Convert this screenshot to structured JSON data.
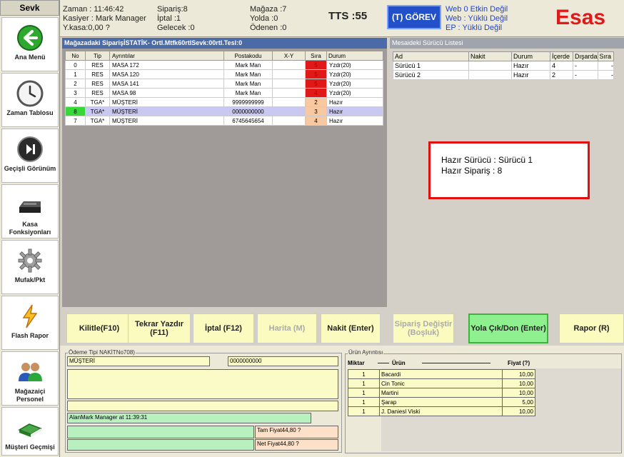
{
  "sidebar": {
    "title": "Sevk",
    "items": [
      {
        "label": "Ana Menü"
      },
      {
        "label": "Zaman Tablosu"
      },
      {
        "label": "Geçişli Görünüm"
      },
      {
        "label": "Kasa Fonksiyonları"
      },
      {
        "label": "Mufak/Pkt"
      },
      {
        "label": "Flash Rapor"
      },
      {
        "label": "Mağazaiçi Personel"
      },
      {
        "label": "Müşteri Geçmişi"
      }
    ]
  },
  "header": {
    "col1": [
      "Zaman : 11:46:42",
      "Kasiyer : Mark Manager",
      "Y.kasa:0,00 ?"
    ],
    "col2": [
      "Sipariş:8",
      "İptal :1",
      "Gelecek :0"
    ],
    "col3": [
      "Mağaza :7",
      "Yolda :0",
      "Ödenen :0"
    ],
    "tts": "TTS :55",
    "gorev": "(T) GÖREV",
    "web": [
      "Web 0 Etkin Değil",
      "Web : Yüklü Değil",
      "EP : Yüklü Değil"
    ],
    "brand": "Esas"
  },
  "orders": {
    "title": "Mağazadaki SiparişİSTATİK- Ortl.Mtfk60rtlSevk:00rtl.Tesl:0",
    "columns": [
      "No",
      "Tip",
      "Ayrıntılar",
      "Postakodu",
      "X-Y",
      "Sıra",
      "Durum"
    ],
    "rows": [
      {
        "no": "0",
        "tip": "RES",
        "detail": "MASA 172",
        "post": "Mark Man",
        "xy": "",
        "sira": "5",
        "durum": "Yzdr(20)",
        "sira_color": "#e01818",
        "no_color": ""
      },
      {
        "no": "1",
        "tip": "RES",
        "detail": "MASA 120",
        "post": "Mark Man",
        "xy": "",
        "sira": "5",
        "durum": "Yzdr(20)",
        "sira_color": "#e01818",
        "no_color": ""
      },
      {
        "no": "2",
        "tip": "RES",
        "detail": "MASA 141",
        "post": "Mark Man",
        "xy": "",
        "sira": "5",
        "durum": "Yzdr(20)",
        "sira_color": "#e01818",
        "no_color": ""
      },
      {
        "no": "3",
        "tip": "RES",
        "detail": "MASA 98",
        "post": "Mark Man",
        "xy": "",
        "sira": "4",
        "durum": "Yzdr(20)",
        "sira_color": "#e01818",
        "no_color": ""
      },
      {
        "no": "4",
        "tip": "TGA*",
        "detail": "MÜŞTERİ",
        "post": "9999999999",
        "xy": "",
        "sira": "2",
        "durum": "Hazır",
        "sira_color": "#f8c8a0",
        "no_color": ""
      },
      {
        "no": "8",
        "tip": "TGA*",
        "detail": "MÜŞTERİ",
        "post": "0000000000",
        "xy": "",
        "sira": "3",
        "durum": "Hazır",
        "sira_color": "#f8c8a0",
        "no_color": "#38d838"
      },
      {
        "no": "7",
        "tip": "TGA*",
        "detail": "MÜŞTERİ",
        "post": "6745645654",
        "xy": "",
        "sira": "4",
        "durum": "Hazır",
        "sira_color": "#f8c8a0",
        "no_color": ""
      }
    ]
  },
  "drivers": {
    "title": "Mesaideki Sürücü Listesi",
    "columns": [
      "Ad",
      "Nakit",
      "Durum",
      "İçerde",
      "Dışarda",
      "Sıra"
    ],
    "rows": [
      {
        "ad": "Sürücü 1",
        "nakit": "",
        "durum": "Hazır",
        "icerde": "4",
        "disarda": "-",
        "sira": "-"
      },
      {
        "ad": "Sürücü 2",
        "nakit": "",
        "durum": "Hazır",
        "icerde": "2",
        "disarda": "-",
        "sira": "-"
      }
    ]
  },
  "ready": {
    "driver": "Hazır Sürücü : Sürücü 1",
    "order": "Hazır Sipariş : 8"
  },
  "buttons": {
    "lock": "Kilitle(F10)",
    "reprint": "Tekrar Yazdır (F11)",
    "cancel": "İptal (F12)",
    "map": "Harita (M)",
    "cash": "Nakit (Enter)",
    "change": "Sipariş Değiştir (Boşluk)",
    "go": "Yola Çık/Don (Enter)",
    "report": "Rapor (R)"
  },
  "payment": {
    "legend": "Ödeme Tipi NAKİTNo708)",
    "customer": "MÜŞTERİ",
    "phone": "0000000000",
    "cashier_line": "AlanMark Manager    at 11:39:31",
    "total": "Tam Fiyat44,80 ?",
    "net": "Net Fiyat44,80 ?"
  },
  "products": {
    "legend": "Ürün Ayrıntısı",
    "col_qty": "Miktar",
    "col_name": "Ürün",
    "col_price": "Fiyat (?)",
    "rows": [
      {
        "qty": "1",
        "name": "Bacardi",
        "price": "10,00"
      },
      {
        "qty": "1",
        "name": "Cin Tonic",
        "price": "10,00"
      },
      {
        "qty": "1",
        "name": "Martini",
        "price": "10,00"
      },
      {
        "qty": "1",
        "name": "Şarap",
        "price": "5,00"
      },
      {
        "qty": "1",
        "name": "J. Daniesl Viski",
        "price": "10,00"
      }
    ]
  },
  "icons": [
    "back-arrow-icon",
    "clock-icon",
    "skip-icon",
    "cash-register-icon",
    "gear-icon",
    "lightning-icon",
    "staff-icon",
    "book-icon"
  ]
}
